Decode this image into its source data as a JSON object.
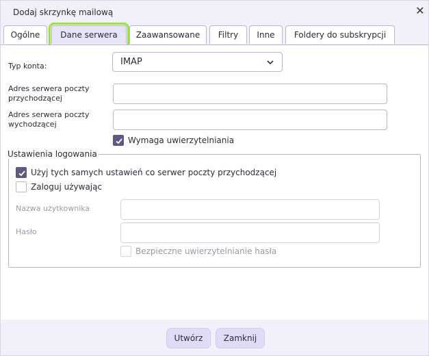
{
  "window": {
    "title": "Dodaj skrzynkę mailową",
    "close_glyph": "✕"
  },
  "tabs": [
    {
      "label": "Ogólne"
    },
    {
      "label": "Dane serwera",
      "active": true
    },
    {
      "label": "Zaawansowane"
    },
    {
      "label": "Filtry"
    },
    {
      "label": "Inne"
    },
    {
      "label": "Foldery do subskrypcji"
    }
  ],
  "server": {
    "account_type_label": "Typ konta:",
    "account_type_value": "IMAP",
    "incoming_label_1": "Adres serwera poczty",
    "incoming_label_2": "przychodzącej",
    "incoming_value": "",
    "outgoing_label_1": "Adres serwera poczty",
    "outgoing_label_2": "wychodzącej",
    "outgoing_value": "",
    "requires_auth_label": "Wymaga uwierzytelniania",
    "requires_auth_checked": true
  },
  "login": {
    "legend": "Ustawienia logowania",
    "same_settings_label": "Użyj tych samych ustawień co serwer poczty przychodzącej",
    "same_settings_checked": true,
    "login_using_label": "Zaloguj używając",
    "login_using_checked": false,
    "username_label": "Nazwa użytkownika",
    "username_value": "",
    "password_label": "Hasło",
    "password_value": "",
    "secure_auth_label": "Bezpieczne uwierzytelnianie hasła",
    "secure_auth_checked": false
  },
  "footer": {
    "create_label": "Utwórz",
    "close_label": "Zamknij"
  },
  "colors": {
    "accent": "#5c5a80",
    "highlight": "#9be33a",
    "button_bg": "#dedcf6"
  },
  "icons": {
    "close": "close-icon",
    "dropdown": "chevron-down-icon",
    "check": "check-icon"
  }
}
